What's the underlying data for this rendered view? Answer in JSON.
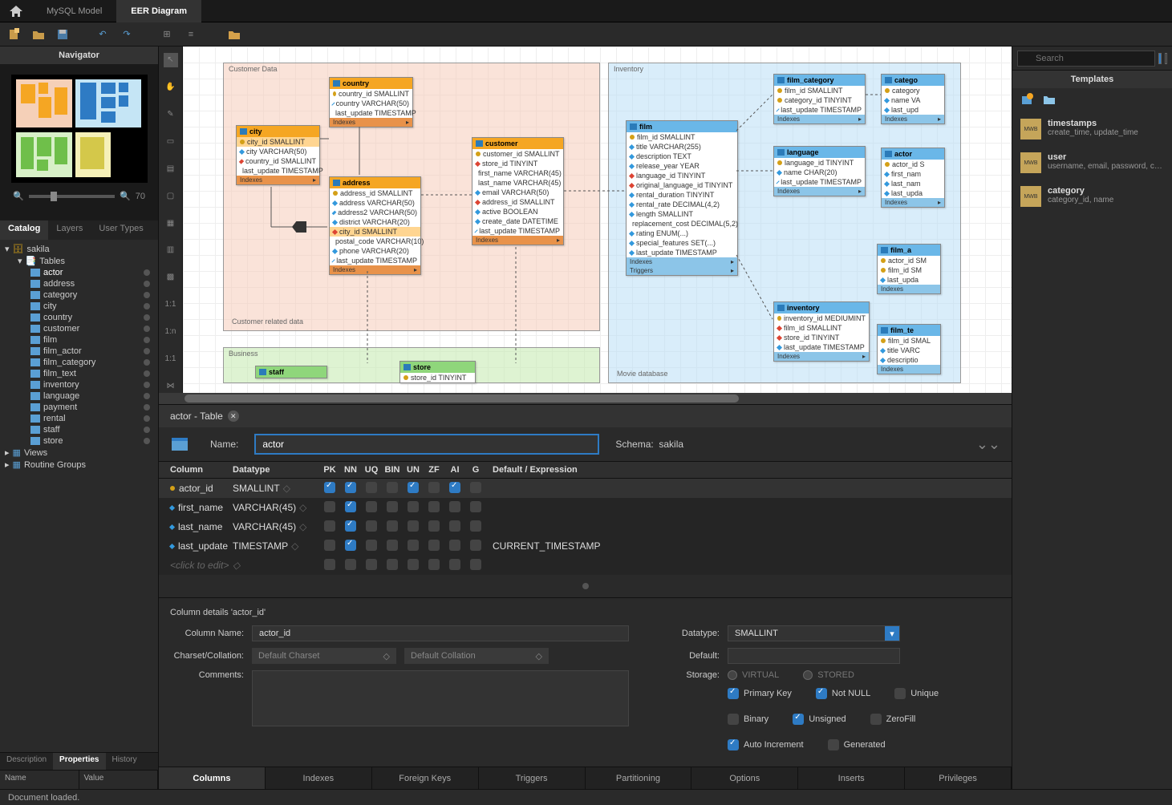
{
  "titlebar": {
    "tabs": [
      "MySQL Model",
      "EER Diagram"
    ],
    "active": 1
  },
  "navigator": {
    "title": "Navigator",
    "zoom": "70"
  },
  "catalog": {
    "tabs": [
      "Catalog",
      "Layers",
      "User Types"
    ],
    "schema": "sakila",
    "tables_label": "Tables",
    "tables": [
      "actor",
      "address",
      "category",
      "city",
      "country",
      "customer",
      "film",
      "film_actor",
      "film_category",
      "film_text",
      "inventory",
      "language",
      "payment",
      "rental",
      "staff",
      "store"
    ],
    "selected": "actor",
    "views_label": "Views",
    "routines_label": "Routine Groups"
  },
  "desc_tabs": [
    "Description",
    "Properties",
    "History"
  ],
  "props_cols": [
    "Name",
    "Value"
  ],
  "diagram": {
    "layers": {
      "customer": {
        "title": "Customer Data",
        "footer": "Customer related data"
      },
      "inventory": {
        "title": "Inventory",
        "footer": "Movie database"
      },
      "business": {
        "title": "Business"
      }
    },
    "tables": {
      "city": {
        "name": "city",
        "cols": [
          "city_id SMALLINT",
          "city VARCHAR(50)",
          "country_id SMALLINT",
          "last_update TIMESTAMP"
        ],
        "idx": "Indexes"
      },
      "country": {
        "name": "country",
        "cols": [
          "country_id SMALLINT",
          "country VARCHAR(50)",
          "last_update TIMESTAMP"
        ],
        "idx": "Indexes"
      },
      "address": {
        "name": "address",
        "cols": [
          "address_id SMALLINT",
          "address VARCHAR(50)",
          "address2 VARCHAR(50)",
          "district VARCHAR(20)",
          "city_id SMALLINT",
          "postal_code VARCHAR(10)",
          "phone VARCHAR(20)",
          "last_update TIMESTAMP"
        ],
        "idx": "Indexes"
      },
      "customer": {
        "name": "customer",
        "cols": [
          "customer_id SMALLINT",
          "store_id TINYINT",
          "first_name VARCHAR(45)",
          "last_name VARCHAR(45)",
          "email VARCHAR(50)",
          "address_id SMALLINT",
          "active BOOLEAN",
          "create_date DATETIME",
          "last_update TIMESTAMP"
        ],
        "idx": "Indexes"
      },
      "film": {
        "name": "film",
        "cols": [
          "film_id SMALLINT",
          "title VARCHAR(255)",
          "description TEXT",
          "release_year YEAR",
          "language_id TINYINT",
          "original_language_id TINYINT",
          "rental_duration TINYINT",
          "rental_rate DECIMAL(4,2)",
          "length SMALLINT",
          "replacement_cost DECIMAL(5,2)",
          "rating ENUM(...)",
          "special_features SET(...)",
          "last_update TIMESTAMP"
        ],
        "idx": "Indexes",
        "trg": "Triggers"
      },
      "film_category": {
        "name": "film_category",
        "cols": [
          "film_id SMALLINT",
          "category_id TINYINT",
          "last_update TIMESTAMP"
        ],
        "idx": "Indexes"
      },
      "language": {
        "name": "language",
        "cols": [
          "language_id TINYINT",
          "name CHAR(20)",
          "last_update TIMESTAMP"
        ],
        "idx": "Indexes"
      },
      "inventory": {
        "name": "inventory",
        "cols": [
          "inventory_id MEDIUMINT",
          "film_id SMALLINT",
          "store_id TINYINT",
          "last_update TIMESTAMP"
        ],
        "idx": "Indexes"
      },
      "category": {
        "name": "catego",
        "cols": [
          "category",
          "name VA",
          "last_upd"
        ],
        "idx": "Indexes"
      },
      "actor": {
        "name": "actor",
        "cols": [
          "actor_id S",
          "first_nam",
          "last_nam",
          "last_upda"
        ],
        "idx": "Indexes"
      },
      "film_actor": {
        "name": "film_a",
        "cols": [
          "actor_id SM",
          "film_id SM",
          "last_upda"
        ],
        "idx": "Indexes"
      },
      "film_text": {
        "name": "film_te",
        "cols": [
          "film_id SMAL",
          "title VARC",
          "descriptio"
        ],
        "idx": "Indexes"
      },
      "staff": {
        "name": "staff"
      },
      "store": {
        "name": "store",
        "cols": [
          "store_id TINYINT"
        ]
      }
    }
  },
  "editor": {
    "tab_title": "actor - Table",
    "name_label": "Name:",
    "name_value": "actor",
    "schema_label": "Schema:",
    "schema_value": "sakila",
    "headers": [
      "Column",
      "Datatype",
      "PK",
      "NN",
      "UQ",
      "BIN",
      "UN",
      "ZF",
      "AI",
      "G",
      "Default / Expression"
    ],
    "rows": [
      {
        "name": "actor_id",
        "type": "SMALLINT",
        "pk": true,
        "nn": true,
        "uq": false,
        "bin": false,
        "un": true,
        "zf": false,
        "ai": true,
        "g": false,
        "def": ""
      },
      {
        "name": "first_name",
        "type": "VARCHAR(45)",
        "pk": false,
        "nn": true,
        "uq": false,
        "bin": false,
        "un": false,
        "zf": false,
        "ai": false,
        "g": false,
        "def": ""
      },
      {
        "name": "last_name",
        "type": "VARCHAR(45)",
        "pk": false,
        "nn": true,
        "uq": false,
        "bin": false,
        "un": false,
        "zf": false,
        "ai": false,
        "g": false,
        "def": ""
      },
      {
        "name": "last_update",
        "type": "TIMESTAMP",
        "pk": false,
        "nn": true,
        "uq": false,
        "bin": false,
        "un": false,
        "zf": false,
        "ai": false,
        "g": false,
        "def": "CURRENT_TIMESTAMP"
      }
    ],
    "placeholder": "<click to edit>",
    "details": {
      "title": "Column details 'actor_id'",
      "col_name_label": "Column Name:",
      "col_name": "actor_id",
      "charset_label": "Charset/Collation:",
      "charset": "Default Charset",
      "collation": "Default Collation",
      "comments_label": "Comments:",
      "datatype_label": "Datatype:",
      "datatype": "SMALLINT",
      "default_label": "Default:",
      "storage_label": "Storage:",
      "virtual": "VIRTUAL",
      "stored": "STORED",
      "checks": [
        {
          "label": "Primary Key",
          "on": true
        },
        {
          "label": "Not NULL",
          "on": true
        },
        {
          "label": "Unique",
          "on": false
        },
        {
          "label": "Binary",
          "on": false
        },
        {
          "label": "Unsigned",
          "on": true
        },
        {
          "label": "ZeroFill",
          "on": false
        },
        {
          "label": "Auto Increment",
          "on": true
        },
        {
          "label": "Generated",
          "on": false
        }
      ]
    },
    "bottom_tabs": [
      "Columns",
      "Indexes",
      "Foreign Keys",
      "Triggers",
      "Partitioning",
      "Options",
      "Inserts",
      "Privileges"
    ]
  },
  "right": {
    "search_placeholder": "Search",
    "templates_title": "Templates",
    "templates": [
      {
        "name": "timestamps",
        "desc": "create_time, update_time"
      },
      {
        "name": "user",
        "desc": "username, email, password, cre..."
      },
      {
        "name": "category",
        "desc": "category_id, name"
      }
    ]
  },
  "status": "Document loaded."
}
